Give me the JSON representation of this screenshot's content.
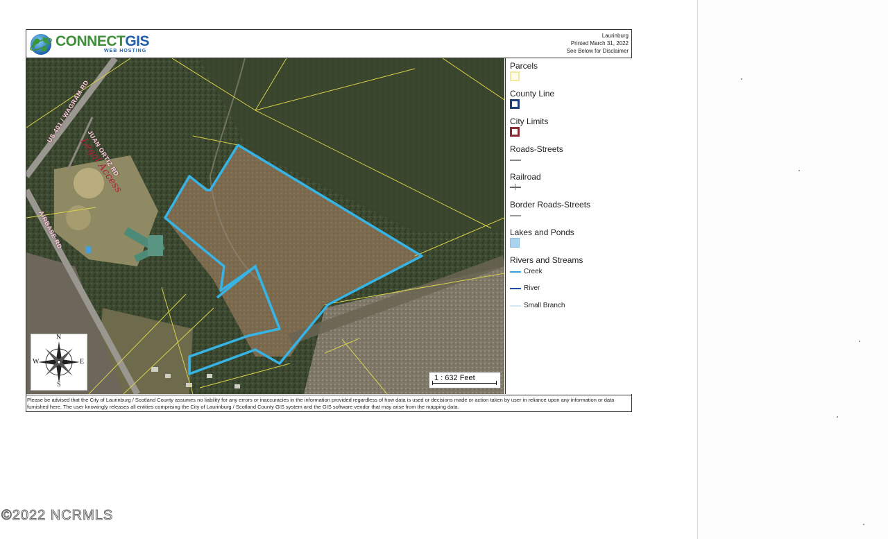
{
  "header": {
    "logo_main": "CONNECT",
    "logo_accent": "GIS",
    "logo_sub": "WEB HOSTING",
    "location": "Laurinburg",
    "printed": "Printed March 31, 2022",
    "disclaimer_ref": "See Below for Disclaimer"
  },
  "legend": {
    "parcels": "Parcels",
    "county_line": "County Line",
    "city_limits": "City Limits",
    "roads_streets": "Roads-Streets",
    "railroad": "Railroad",
    "border_roads": "Border Roads-Streets",
    "lakes_ponds": "Lakes and Ponds",
    "rivers_streams": "Rivers and Streams",
    "creek": "Creek",
    "river": "River",
    "small_branch": "Small Branch"
  },
  "colors": {
    "parcels": "#f2e9a0",
    "county_line": "#1f3f7a",
    "city_limits": "#8b2b33",
    "lakes": "#a8d4ee",
    "creek": "#3aa0d8",
    "river": "#1f4f9a",
    "small_branch": "#d5e6f0",
    "outline": "#37b4e6",
    "parcel_lines": "#d9d24a"
  },
  "map": {
    "roads": {
      "us401": "US 401 / WAGRAM RD",
      "juan_ortiz": "JUAN ORTIZ RD",
      "airbase": "AIRBASE RD"
    },
    "annotation": "Legal Access",
    "scale": "1 : 632 Feet",
    "compass": {
      "n": "N",
      "s": "S",
      "e": "E",
      "w": "W"
    }
  },
  "disclaimer": "Please be advised that the City of Laurinburg / Scotland County assumes no liability for any errors or inaccuracies in the information provided regardless of how data is used or decisions made or action taken by user in reliance upon any information or data furnished here. The user knowingly releases all entities comprising the City of Laurinburg / Scotland County GIS system and the GIS software vendor that may arise from the mapping data.",
  "watermark": "©2022 NCRMLS"
}
